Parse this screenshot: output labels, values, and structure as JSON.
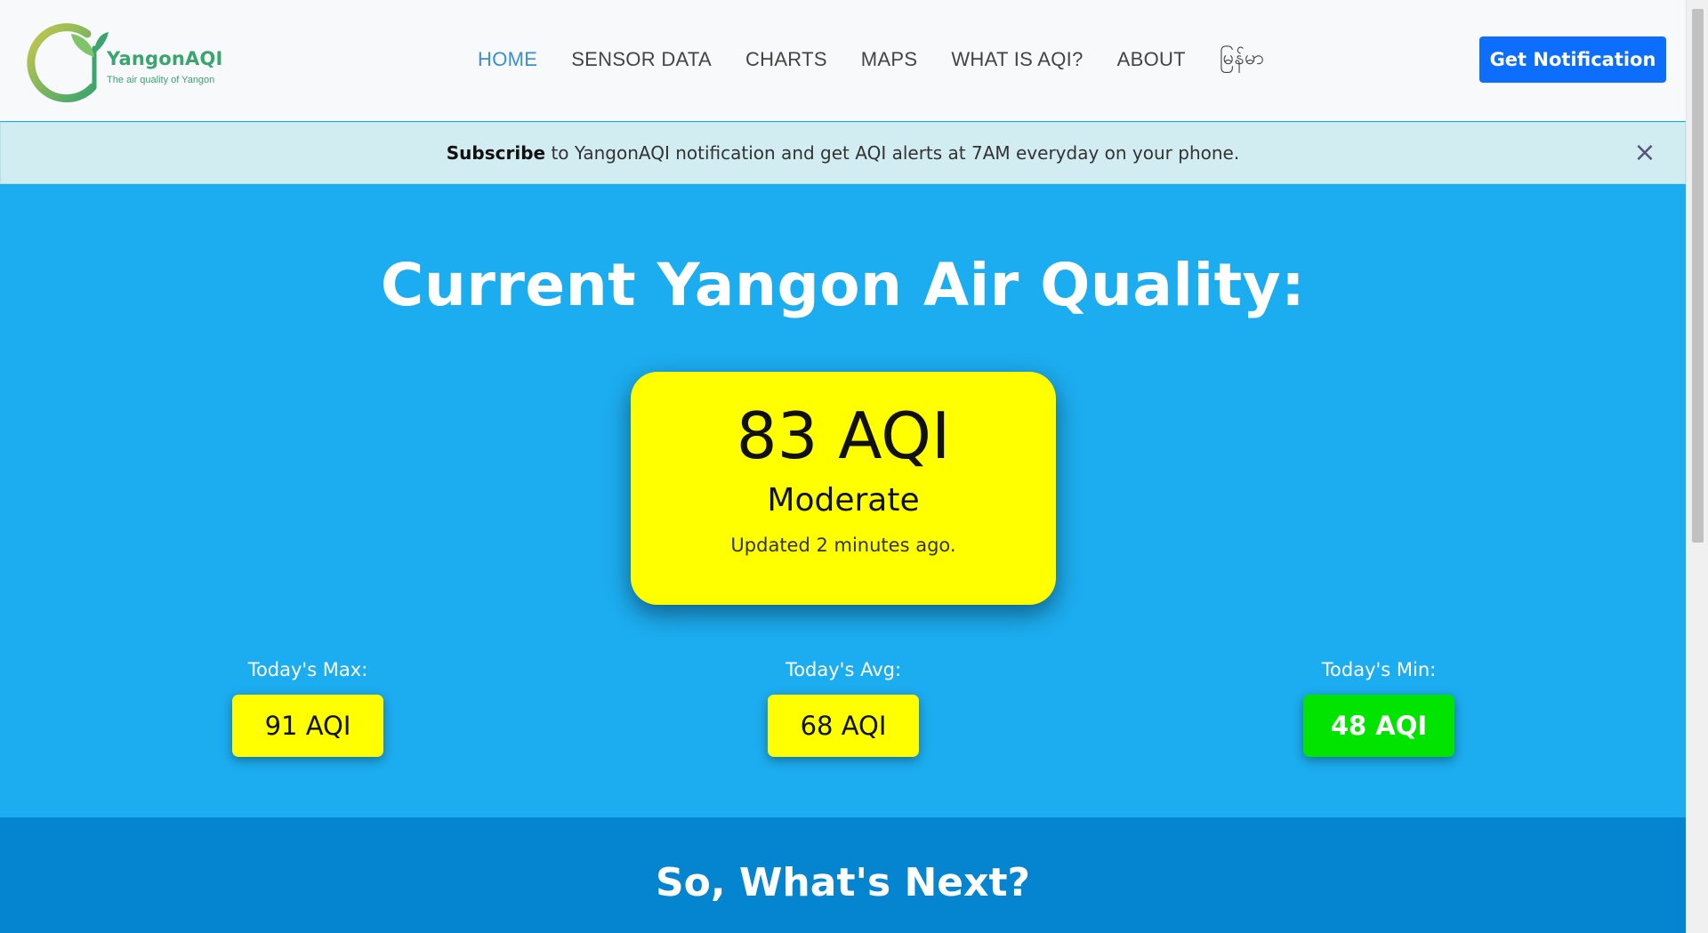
{
  "logo": {
    "name": "YangonAQI",
    "tagline": "The air quality of Yangon"
  },
  "nav": {
    "items": [
      "HOME",
      "SENSOR DATA",
      "CHARTS",
      "MAPS",
      "WHAT IS AQI?",
      "ABOUT",
      "မြန်မာ"
    ],
    "active": "HOME"
  },
  "notify_button": "Get Notification",
  "alert": {
    "bold": "Subscribe",
    "text": " to YangonAQI notification and get AQI alerts at 7AM everyday on your phone.",
    "close": "×"
  },
  "hero": {
    "title": "Current Yangon Air Quality:",
    "current": {
      "value": "83 AQI",
      "label": "Moderate",
      "updated": "Updated 2 minutes ago.",
      "color": "#ffff00"
    },
    "max": {
      "label": "Today's Max:",
      "value": "91 AQI",
      "color": "#ffff00"
    },
    "avg": {
      "label": "Today's Avg:",
      "value": "68 AQI",
      "color": "#ffff00"
    },
    "min": {
      "label": "Today's Min:",
      "value": "48 AQI",
      "color": "#00e400"
    }
  },
  "next": {
    "title": "So, What's Next?"
  },
  "colors": {
    "hero_bg": "#1cadf0",
    "next_bg": "#0585d0",
    "button": "#0d6efd",
    "brand_green": "#3aa56e"
  }
}
